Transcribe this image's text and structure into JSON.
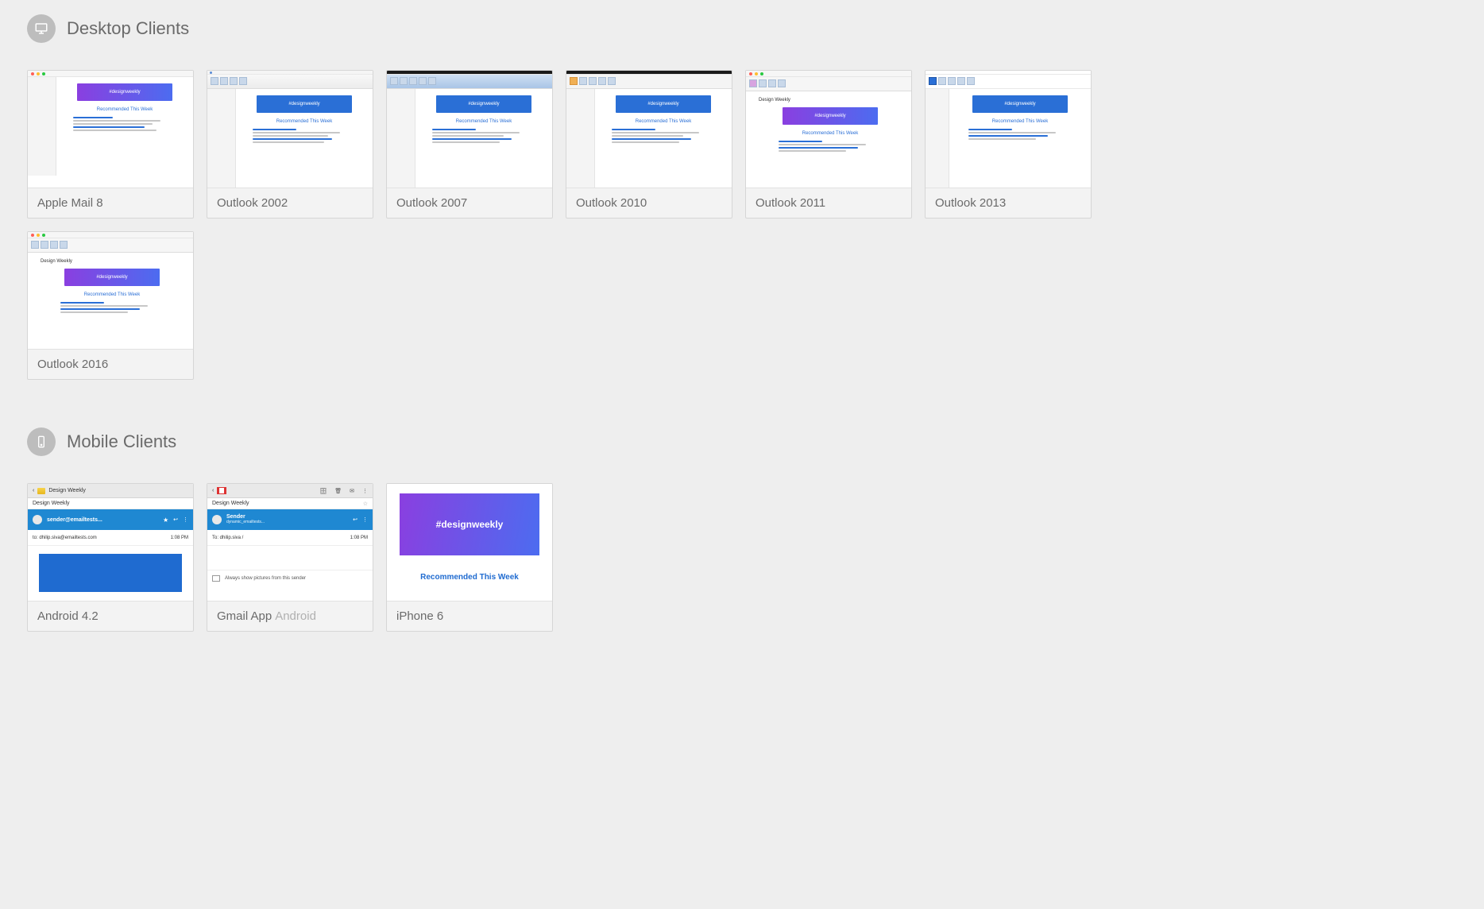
{
  "sections": {
    "desktop": {
      "title": "Desktop Clients",
      "icon": "desktop-icon",
      "items": [
        {
          "label": "Apple Mail 8",
          "style": "mac",
          "banner": "purple",
          "banner_text": "#designweekly",
          "rec": "Recommended This Week"
        },
        {
          "label": "Outlook 2002",
          "style": "win-classic",
          "banner": "blue",
          "banner_text": "#designweekly",
          "rec": "Recommended This Week"
        },
        {
          "label": "Outlook 2007",
          "style": "win-dark",
          "banner": "blue",
          "banner_text": "#designweekly",
          "rec": "Recommended This Week"
        },
        {
          "label": "Outlook 2010",
          "style": "win-dark",
          "banner": "blue",
          "banner_text": "#designweekly",
          "rec": "Recommended This Week"
        },
        {
          "label": "Outlook 2011",
          "style": "mac-ribbon",
          "banner": "purple",
          "banner_text": "#designweekly",
          "rec": "Recommended This Week"
        },
        {
          "label": "Outlook 2013",
          "style": "win-flat",
          "banner": "blue",
          "banner_text": "#designweekly",
          "rec": "Recommended This Week"
        },
        {
          "label": "Outlook 2016",
          "style": "mac-ribbon",
          "banner": "purple",
          "banner_text": "#designweekly",
          "rec": "Recommended This Week"
        }
      ]
    },
    "mobile": {
      "title": "Mobile Clients",
      "icon": "mobile-icon",
      "items": [
        {
          "label": "Android 4.2",
          "sublabel": "",
          "variant": "android42",
          "subject": "Design Weekly",
          "sender": "sender@emailtests...",
          "preview_line": "to: dhilip.siva@emailtests.com",
          "timestamp": "1:08 PM"
        },
        {
          "label": "Gmail App",
          "sublabel": "Android",
          "variant": "gmailapp",
          "subject": "Design Weekly",
          "sender": "Sender",
          "sender_email": "dynamic_emailtests...",
          "preview_line": "To: dhilip.siva /",
          "timestamp": "1:08 PM",
          "footer": "Always show pictures from this sender"
        },
        {
          "label": "iPhone 6",
          "sublabel": "",
          "variant": "iphone6",
          "banner_text": "#designweekly",
          "rec": "Recommended This Week"
        }
      ]
    }
  }
}
